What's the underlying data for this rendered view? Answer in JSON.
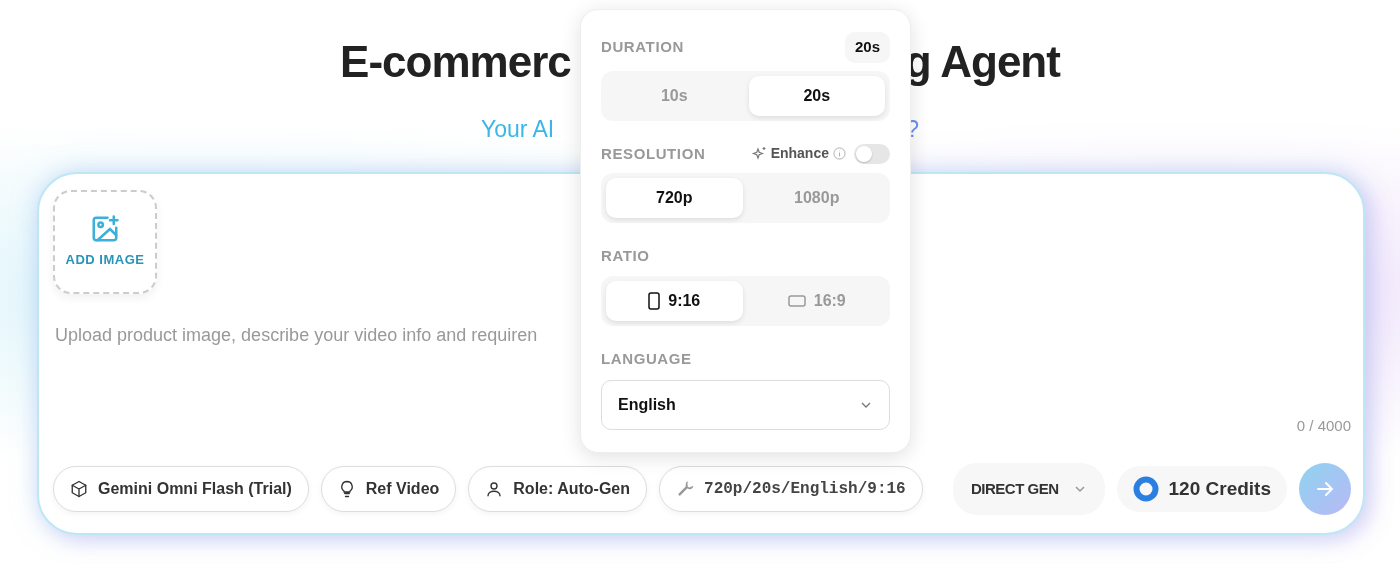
{
  "title": {
    "left": "E-commerc",
    "right": "g Agent"
  },
  "subtitle": {
    "left": "Your AI",
    "right": "?"
  },
  "add_image": {
    "label": "ADD IMAGE"
  },
  "prompt": {
    "placeholder": "Upload product image, describe your video info and requiren"
  },
  "counter": "0 / 4000",
  "chips": [
    {
      "kind": "model",
      "label": "Gemini Omni Flash (Trial)"
    },
    {
      "kind": "ref",
      "label": "Ref Video"
    },
    {
      "kind": "role",
      "label": "Role: Auto-Gen"
    },
    {
      "kind": "settings",
      "label": "720p/20s/English/9:16"
    }
  ],
  "mode": {
    "label": "DIRECT GEN"
  },
  "credits": {
    "label": "120 Credits"
  },
  "popup": {
    "duration": {
      "label": "DURATION",
      "badge": "20s",
      "options": [
        {
          "label": "10s",
          "selected": false
        },
        {
          "label": "20s",
          "selected": true
        }
      ]
    },
    "resolution": {
      "label": "RESOLUTION",
      "enhance": {
        "label": "Enhance",
        "on": false
      },
      "options": [
        {
          "label": "720p",
          "selected": true
        },
        {
          "label": "1080p",
          "selected": false
        }
      ]
    },
    "ratio": {
      "label": "RATIO",
      "options": [
        {
          "label": "9:16",
          "kind": "portrait",
          "selected": true
        },
        {
          "label": "16:9",
          "kind": "landscape",
          "selected": false
        }
      ]
    },
    "language": {
      "label": "LANGUAGE",
      "value": "English"
    }
  }
}
